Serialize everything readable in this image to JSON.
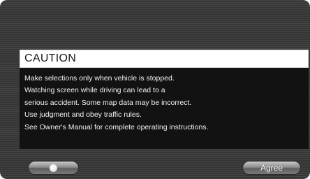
{
  "dialog": {
    "title": "CAUTION",
    "lines": [
      "Make selections only when vehicle is stopped.",
      "Watching screen while driving can lead to a",
      "serious accident. Some map data may be incorrect.",
      "Use judgment and obey traffic rules.",
      "See Owner's Manual for complete operating instructions."
    ]
  },
  "buttons": {
    "left_icon": "circle-icon",
    "agree_label": "Agree"
  }
}
